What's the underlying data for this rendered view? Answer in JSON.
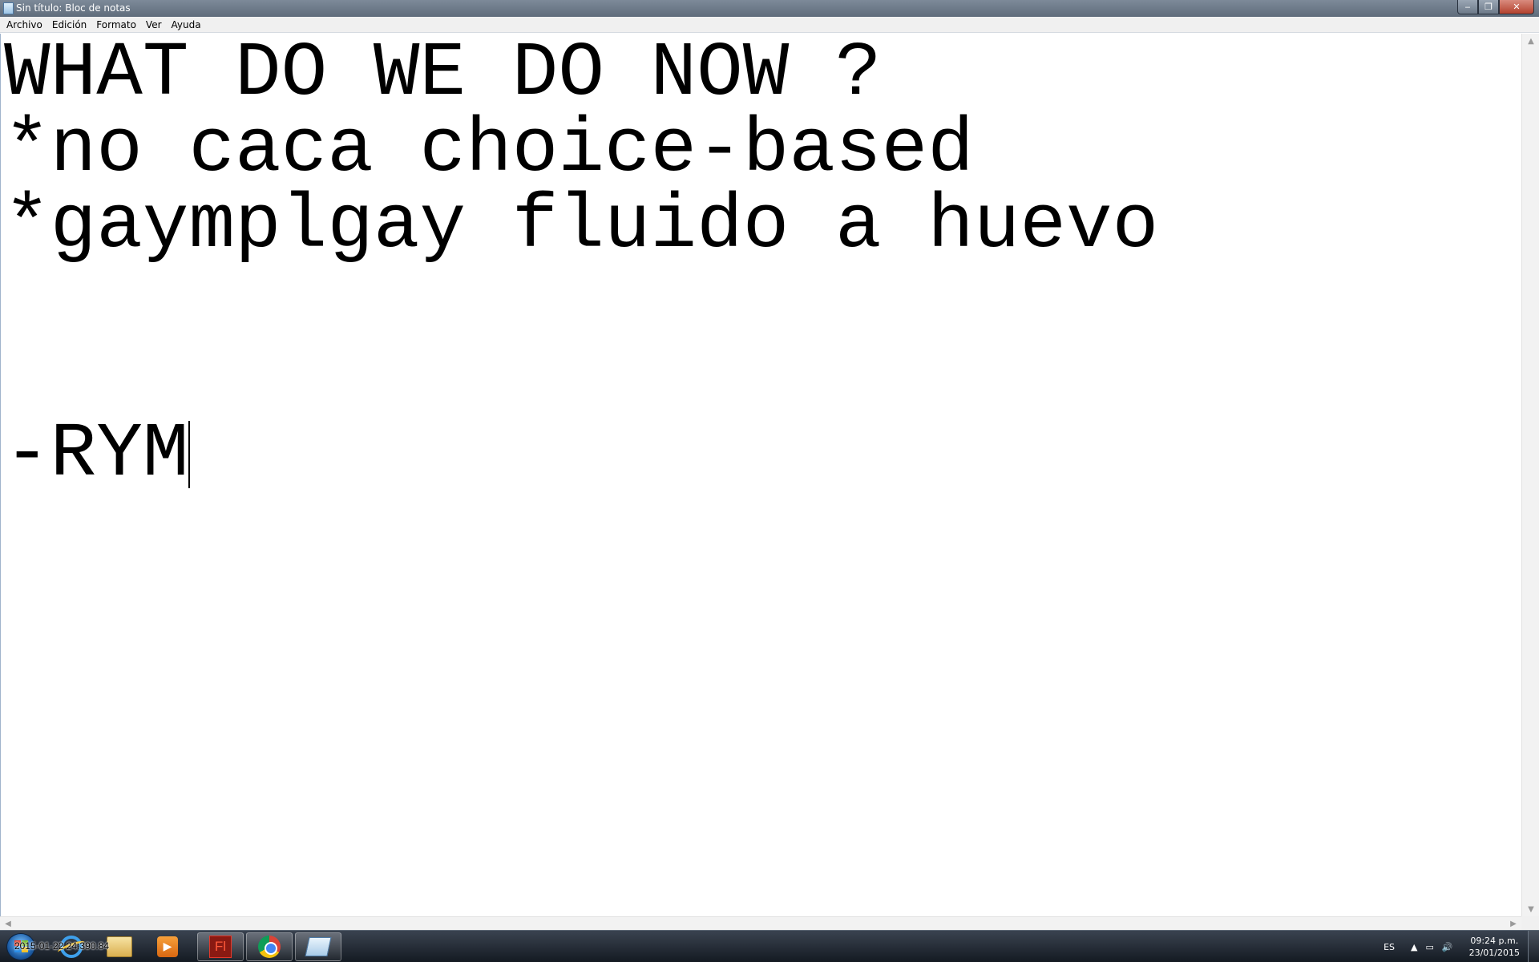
{
  "window": {
    "title": "Sin título: Bloc de notas",
    "buttons": {
      "minimize": "‒",
      "maximize": "❐",
      "close": "✕"
    }
  },
  "menu": [
    "Archivo",
    "Edición",
    "Formato",
    "Ver",
    "Ayuda"
  ],
  "editor": {
    "lines": [
      "WHAT DO WE DO NOW ?",
      "*no caca choice-based",
      "*gaymplgay fluido a huevo",
      "",
      "",
      "-RYM"
    ]
  },
  "taskbar": {
    "overlay_text": "2015-01-22 24:390.84",
    "pinned": [
      "start-orb",
      "internet-explorer-icon",
      "windows-explorer-icon",
      "media-player-icon",
      "flash-icon",
      "chrome-icon",
      "notepad-icon"
    ],
    "tray": {
      "language": "ES",
      "time": "09:24 p.m.",
      "date": "23/01/2015"
    }
  }
}
